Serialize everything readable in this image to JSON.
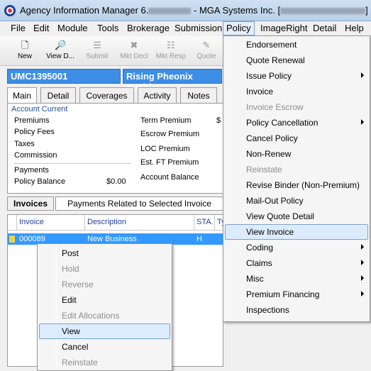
{
  "window": {
    "title_prefix": "Agency Information Manager 6.",
    "title_mid": " - MGA Systems Inc. ["
  },
  "menubar": [
    "File",
    "Edit",
    "Module",
    "Tools",
    "Brokerage",
    "Submission",
    "Policy",
    "ImageRight",
    "Detail",
    "Help"
  ],
  "toolbar": [
    {
      "label": "New",
      "enabled": true,
      "icon": "new-document-icon"
    },
    {
      "label": "View D...",
      "enabled": true,
      "icon": "view-document-icon"
    },
    {
      "label": "Submit",
      "enabled": false,
      "icon": "submit-icon"
    },
    {
      "label": "Mkt Decl",
      "enabled": false,
      "icon": "market-decline-icon"
    },
    {
      "label": "Mkt Resp",
      "enabled": false,
      "icon": "market-response-icon"
    },
    {
      "label": "Quote",
      "enabled": false,
      "icon": "quote-icon"
    }
  ],
  "record": {
    "id": "UMC1395001",
    "name": "Rising Pheonix Sushi"
  },
  "tabs": [
    "Main",
    "Detail",
    "Coverages",
    "Activity",
    "Notes"
  ],
  "account": {
    "header": "Account Current",
    "left": [
      "Premiums",
      "Policy Fees",
      "Taxes",
      "Commission"
    ],
    "payments": "Payments",
    "policy_balance_label": "Policy Balance",
    "policy_balance_value": "$0.00",
    "right": [
      "Term Premium",
      "Escrow Premium",
      "LOC Premium",
      "Est. FT Premium",
      "Account Balance"
    ],
    "term_premium_partial": "$"
  },
  "invoice_tabs": [
    "Invoices",
    "Payments Related to Selected Invoice"
  ],
  "grid": {
    "columns": [
      "Invoice",
      "Description",
      "STA.",
      "Ty"
    ],
    "rows": [
      {
        "invoice": "000089",
        "description": "New Business",
        "status": "H"
      }
    ]
  },
  "context_menu": [
    {
      "label": "Post",
      "enabled": true
    },
    {
      "label": "Hold",
      "enabled": false
    },
    {
      "label": "Reverse",
      "enabled": false
    },
    {
      "label": "Edit",
      "enabled": true
    },
    {
      "label": "Edit Allocations",
      "enabled": false
    },
    {
      "label": "View",
      "enabled": true,
      "highlighted": true
    },
    {
      "label": "Cancel",
      "enabled": true
    },
    {
      "label": "Reinstate",
      "enabled": false
    }
  ],
  "policy_menu": [
    {
      "label": "Endorsement",
      "enabled": true,
      "submenu": false
    },
    {
      "label": "Quote Renewal",
      "enabled": true,
      "submenu": false
    },
    {
      "label": "Issue Policy",
      "enabled": true,
      "submenu": true
    },
    {
      "label": "Invoice",
      "enabled": true,
      "submenu": false
    },
    {
      "label": "Invoice Escrow",
      "enabled": false,
      "submenu": false
    },
    {
      "label": "Policy Cancellation",
      "enabled": true,
      "submenu": true
    },
    {
      "label": "Cancel Policy",
      "enabled": true,
      "submenu": false
    },
    {
      "label": "Non-Renew",
      "enabled": true,
      "submenu": false
    },
    {
      "label": "Reinstate",
      "enabled": false,
      "submenu": false
    },
    {
      "label": "Revise Binder (Non-Premium)",
      "enabled": true,
      "submenu": false
    },
    {
      "label": "Mail-Out Policy",
      "enabled": true,
      "submenu": false
    },
    {
      "label": "View Quote Detail",
      "enabled": true,
      "submenu": false
    },
    {
      "label": "View Invoice",
      "enabled": true,
      "submenu": false,
      "highlighted": true
    },
    {
      "label": "Coding",
      "enabled": true,
      "submenu": true
    },
    {
      "label": "Claims",
      "enabled": true,
      "submenu": true
    },
    {
      "label": "Misc",
      "enabled": true,
      "submenu": true
    },
    {
      "label": "Premium Financing",
      "enabled": true,
      "submenu": true
    },
    {
      "label": "Inspections",
      "enabled": true,
      "submenu": false
    }
  ]
}
